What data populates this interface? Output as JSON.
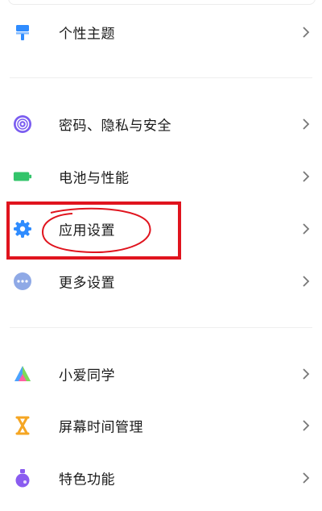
{
  "settings": {
    "group1": [
      {
        "label": "个性主题",
        "icon": "paint-roller-icon",
        "color": "#2f8cff"
      }
    ],
    "group2": [
      {
        "label": "密码、隐私与安全",
        "icon": "fingerprint-icon",
        "color": "#7a5cf0"
      },
      {
        "label": "电池与性能",
        "icon": "battery-icon",
        "color": "#33c46a"
      },
      {
        "label": "应用设置",
        "icon": "gear-icon",
        "color": "#2f8cff"
      },
      {
        "label": "更多设置",
        "icon": "more-dots-icon",
        "color": "#8fa9e6"
      }
    ],
    "group3": [
      {
        "label": "小爱同学",
        "icon": "xiaoai-icon",
        "color": "#4aa3ff"
      },
      {
        "label": "屏幕时间管理",
        "icon": "hourglass-icon",
        "color": "#f5a623"
      },
      {
        "label": "特色功能",
        "icon": "flask-icon",
        "color": "#8a5cf0"
      }
    ]
  },
  "annotation": {
    "color": "#e0141e"
  }
}
